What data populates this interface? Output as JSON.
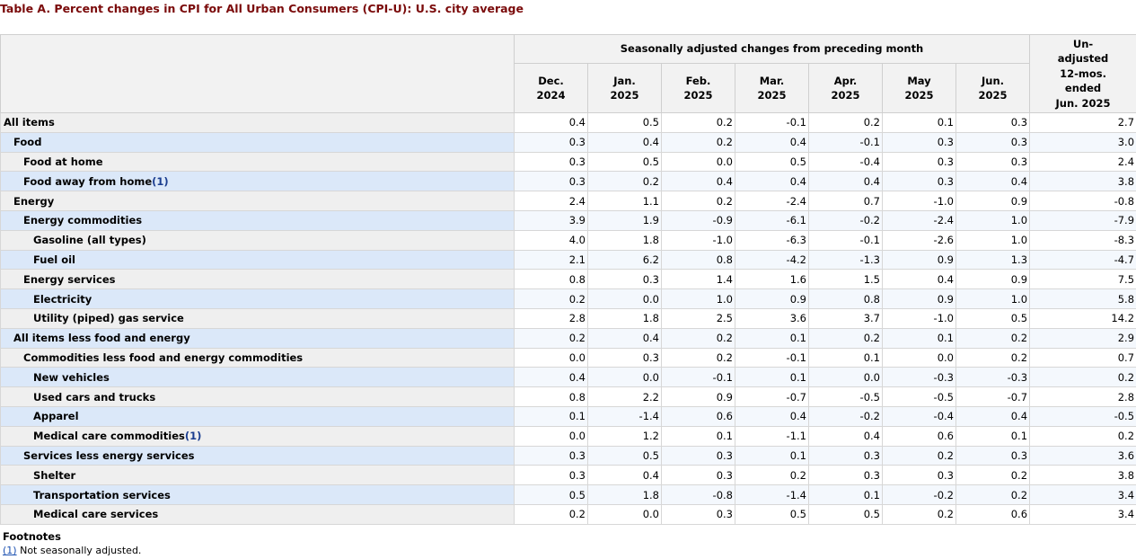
{
  "caption": "Table A. Percent changes in CPI for All Urban Consumers (CPI-U): U.S. city average",
  "header": {
    "group_label": "Seasonally adjusted changes from preceding month",
    "months": [
      {
        "line1": "Dec.",
        "line2": "2024"
      },
      {
        "line1": "Jan.",
        "line2": "2025"
      },
      {
        "line1": "Feb.",
        "line2": "2025"
      },
      {
        "line1": "Mar.",
        "line2": "2025"
      },
      {
        "line1": "Apr.",
        "line2": "2025"
      },
      {
        "line1": "May",
        "line2": "2025"
      },
      {
        "line1": "Jun.",
        "line2": "2025"
      }
    ],
    "unadj_lines": [
      "Un-",
      "adjusted",
      "12-mos.",
      "ended",
      "Jun. 2025"
    ]
  },
  "rows": [
    {
      "label": "All items",
      "indent": 0,
      "footnote": "",
      "values": [
        "0.4",
        "0.5",
        "0.2",
        "-0.1",
        "0.2",
        "0.1",
        "0.3",
        "2.7"
      ]
    },
    {
      "label": "Food",
      "indent": 1,
      "footnote": "",
      "values": [
        "0.3",
        "0.4",
        "0.2",
        "0.4",
        "-0.1",
        "0.3",
        "0.3",
        "3.0"
      ]
    },
    {
      "label": "Food at home",
      "indent": 2,
      "footnote": "",
      "values": [
        "0.3",
        "0.5",
        "0.0",
        "0.5",
        "-0.4",
        "0.3",
        "0.3",
        "2.4"
      ]
    },
    {
      "label": "Food away from home",
      "indent": 2,
      "footnote": "(1)",
      "values": [
        "0.3",
        "0.2",
        "0.4",
        "0.4",
        "0.4",
        "0.3",
        "0.4",
        "3.8"
      ]
    },
    {
      "label": "Energy",
      "indent": 1,
      "footnote": "",
      "values": [
        "2.4",
        "1.1",
        "0.2",
        "-2.4",
        "0.7",
        "-1.0",
        "0.9",
        "-0.8"
      ]
    },
    {
      "label": "Energy commodities",
      "indent": 2,
      "footnote": "",
      "values": [
        "3.9",
        "1.9",
        "-0.9",
        "-6.1",
        "-0.2",
        "-2.4",
        "1.0",
        "-7.9"
      ]
    },
    {
      "label": "Gasoline (all types)",
      "indent": 3,
      "footnote": "",
      "values": [
        "4.0",
        "1.8",
        "-1.0",
        "-6.3",
        "-0.1",
        "-2.6",
        "1.0",
        "-8.3"
      ]
    },
    {
      "label": "Fuel oil",
      "indent": 3,
      "footnote": "",
      "values": [
        "2.1",
        "6.2",
        "0.8",
        "-4.2",
        "-1.3",
        "0.9",
        "1.3",
        "-4.7"
      ]
    },
    {
      "label": "Energy services",
      "indent": 2,
      "footnote": "",
      "values": [
        "0.8",
        "0.3",
        "1.4",
        "1.6",
        "1.5",
        "0.4",
        "0.9",
        "7.5"
      ]
    },
    {
      "label": "Electricity",
      "indent": 3,
      "footnote": "",
      "values": [
        "0.2",
        "0.0",
        "1.0",
        "0.9",
        "0.8",
        "0.9",
        "1.0",
        "5.8"
      ]
    },
    {
      "label": "Utility (piped) gas service",
      "indent": 3,
      "footnote": "",
      "values": [
        "2.8",
        "1.8",
        "2.5",
        "3.6",
        "3.7",
        "-1.0",
        "0.5",
        "14.2"
      ]
    },
    {
      "label": "All items less food and energy",
      "indent": 1,
      "footnote": "",
      "values": [
        "0.2",
        "0.4",
        "0.2",
        "0.1",
        "0.2",
        "0.1",
        "0.2",
        "2.9"
      ]
    },
    {
      "label": "Commodities less food and energy commodities",
      "indent": 2,
      "footnote": "",
      "values": [
        "0.0",
        "0.3",
        "0.2",
        "-0.1",
        "0.1",
        "0.0",
        "0.2",
        "0.7"
      ]
    },
    {
      "label": "New vehicles",
      "indent": 3,
      "footnote": "",
      "values": [
        "0.4",
        "0.0",
        "-0.1",
        "0.1",
        "0.0",
        "-0.3",
        "-0.3",
        "0.2"
      ]
    },
    {
      "label": "Used cars and trucks",
      "indent": 3,
      "footnote": "",
      "values": [
        "0.8",
        "2.2",
        "0.9",
        "-0.7",
        "-0.5",
        "-0.5",
        "-0.7",
        "2.8"
      ]
    },
    {
      "label": "Apparel",
      "indent": 3,
      "footnote": "",
      "values": [
        "0.1",
        "-1.4",
        "0.6",
        "0.4",
        "-0.2",
        "-0.4",
        "0.4",
        "-0.5"
      ]
    },
    {
      "label": "Medical care commodities",
      "indent": 3,
      "footnote": "(1)",
      "values": [
        "0.0",
        "1.2",
        "0.1",
        "-1.1",
        "0.4",
        "0.6",
        "0.1",
        "0.2"
      ]
    },
    {
      "label": "Services less energy services",
      "indent": 2,
      "footnote": "",
      "values": [
        "0.3",
        "0.5",
        "0.3",
        "0.1",
        "0.3",
        "0.2",
        "0.3",
        "3.6"
      ]
    },
    {
      "label": "Shelter",
      "indent": 3,
      "footnote": "",
      "values": [
        "0.3",
        "0.4",
        "0.3",
        "0.2",
        "0.3",
        "0.3",
        "0.2",
        "3.8"
      ]
    },
    {
      "label": "Transportation services",
      "indent": 3,
      "footnote": "",
      "values": [
        "0.5",
        "1.8",
        "-0.8",
        "-1.4",
        "0.1",
        "-0.2",
        "0.2",
        "3.4"
      ]
    },
    {
      "label": "Medical care services",
      "indent": 3,
      "footnote": "",
      "values": [
        "0.2",
        "0.0",
        "0.3",
        "0.5",
        "0.5",
        "0.2",
        "0.6",
        "3.4"
      ]
    }
  ],
  "footnotes": {
    "title": "Footnotes",
    "items": [
      {
        "ref": "(1)",
        "text": " Not seasonally adjusted."
      }
    ]
  },
  "colors": {
    "caption": "#7a0a0a",
    "row_alt_label_bg": "#dbe8f9",
    "row_label_bg": "#efefef",
    "header_bg": "#f2f2f2",
    "link": "#1a4fb0"
  }
}
